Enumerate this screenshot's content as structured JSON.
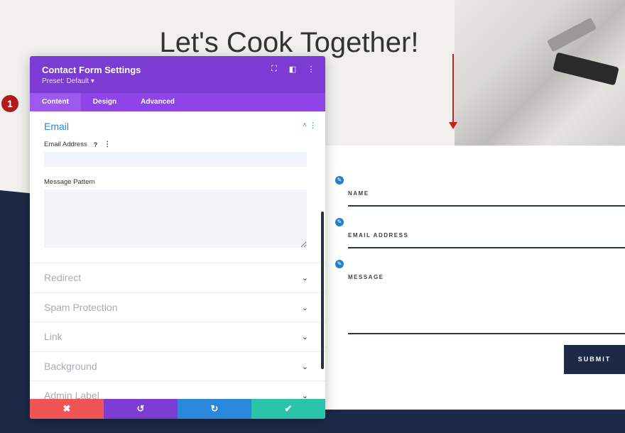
{
  "page": {
    "title": "Let's Cook Together!"
  },
  "form": {
    "fields": [
      {
        "label": "NAME"
      },
      {
        "label": "EMAIL ADDRESS"
      },
      {
        "label": "MESSAGE"
      }
    ],
    "submit_label": "SUBMIT"
  },
  "modal": {
    "title": "Contact Form Settings",
    "preset": "Preset: Default ▾",
    "tabs": [
      {
        "label": "Content",
        "active": true
      },
      {
        "label": "Design",
        "active": false
      },
      {
        "label": "Advanced",
        "active": false
      }
    ],
    "email_section": {
      "title": "Email",
      "email_address_label": "Email Address",
      "email_address_value": "",
      "message_pattern_label": "Message Pattern",
      "message_pattern_value": "",
      "help_glyph": "?",
      "more_glyph": "⋮",
      "toggle_glyph": "˄"
    },
    "collapsed_sections": [
      {
        "label": "Redirect"
      },
      {
        "label": "Spam Protection"
      },
      {
        "label": "Link"
      },
      {
        "label": "Background"
      },
      {
        "label": "Admin Label"
      }
    ],
    "footer": {
      "cancel_glyph": "✖",
      "undo_glyph": "↺",
      "redo_glyph": "↻",
      "save_glyph": "✔"
    }
  },
  "annotation": {
    "step_number": "1"
  },
  "colors": {
    "header_purple": "#7c3bd2",
    "tab_purple": "#8e44e6",
    "accent_blue": "#2b87da",
    "cancel_red": "#ef5555",
    "save_teal": "#29c4a9",
    "navy": "#1c2a47",
    "arrow_red": "#c81f1f"
  }
}
